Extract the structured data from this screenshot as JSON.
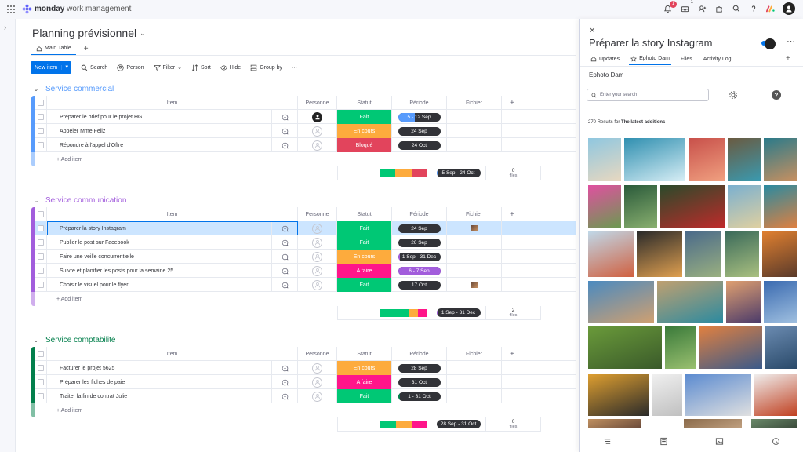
{
  "app": {
    "brand_bold": "monday",
    "brand_rest": " work management",
    "notif_count": "1",
    "inbox_count": "1"
  },
  "board": {
    "title": "Planning prévisionnel",
    "tab_main": "Main Table",
    "tab_add": "+"
  },
  "toolbar": {
    "new_item": "New item",
    "search": "Search",
    "person": "Person",
    "filter": "Filter",
    "sort": "Sort",
    "hide": "Hide",
    "group_by": "Group by",
    "more": "···"
  },
  "columns": {
    "item": "Item",
    "person": "Personne",
    "status": "Statut",
    "period": "Période",
    "file": "Fichier",
    "add": "+"
  },
  "add_item_label": "+ Add item",
  "files_label": "files",
  "groups": [
    {
      "name": "Service commercial",
      "color": "#579bfc",
      "rows": [
        {
          "item": "Préparer le brief pour le projet HGT",
          "person": "dark",
          "status": "Fait",
          "status_color": "#00c875",
          "period": "5 - 12 Sep",
          "progress": 0.4,
          "prog_color": "#579bfc",
          "file": ""
        },
        {
          "item": "Appeler Mme Feliz",
          "person": "empty",
          "status": "En cours",
          "status_color": "#fdab3d",
          "period": "24 Sep",
          "progress": 0,
          "prog_color": "",
          "file": ""
        },
        {
          "item": "Répondre à l'appel d'Offre",
          "person": "empty",
          "status": "Bloqué",
          "status_color": "#e2445c",
          "period": "24 Oct",
          "progress": 0,
          "prog_color": "",
          "file": ""
        }
      ],
      "summary": {
        "period": "5 Sep - 24 Oct",
        "files_count": "0",
        "bar": [
          [
            "#00c875",
            0.33
          ],
          [
            "#fdab3d",
            0.34
          ],
          [
            "#e2445c",
            0.33
          ]
        ],
        "progress": 0.05,
        "prog_color": "#579bfc"
      }
    },
    {
      "name": "Service communication",
      "color": "#a25ddc",
      "rows": [
        {
          "item": "Préparer la story Instagram",
          "person": "empty",
          "status": "Fait",
          "status_color": "#00c875",
          "period": "24 Sep",
          "progress": 0,
          "prog_color": "",
          "file": "thumb",
          "selected": true
        },
        {
          "item": "Publier le post sur Facebook",
          "person": "empty",
          "status": "Fait",
          "status_color": "#00c875",
          "period": "26 Sep",
          "progress": 0,
          "prog_color": "",
          "file": ""
        },
        {
          "item": "Faire une veille concurrentielle",
          "person": "empty",
          "status": "En cours",
          "status_color": "#fdab3d",
          "period": "1 Sep - 31 Dec",
          "progress": 0.05,
          "prog_color": "#a25ddc",
          "file": ""
        },
        {
          "item": "Suivre et planifier les posts pour la semaine 25",
          "person": "empty",
          "status": "A faire",
          "status_color": "#ff158a",
          "period": "6 - 7 Sep",
          "progress": 1,
          "prog_color": "#a25ddc",
          "file": ""
        },
        {
          "item": "Choisir le visuel pour le flyer",
          "person": "empty",
          "status": "Fait",
          "status_color": "#00c875",
          "period": "17 Oct",
          "progress": 0,
          "prog_color": "",
          "file": "thumb"
        }
      ],
      "summary": {
        "period": "1 Sep - 31 Dec",
        "files_count": "2",
        "bar": [
          [
            "#00c875",
            0.6
          ],
          [
            "#fdab3d",
            0.2
          ],
          [
            "#ff158a",
            0.2
          ]
        ],
        "progress": 0.05,
        "prog_color": "#a25ddc"
      }
    },
    {
      "name": "Service comptabilité",
      "color": "#037f4c",
      "rows": [
        {
          "item": "Facturer le projet 5625",
          "person": "empty",
          "status": "En cours",
          "status_color": "#fdab3d",
          "period": "28 Sep",
          "progress": 0,
          "prog_color": "",
          "file": ""
        },
        {
          "item": "Préparer les fiches de paie",
          "person": "empty",
          "status": "A faire",
          "status_color": "#ff158a",
          "period": "31 Oct",
          "progress": 0,
          "prog_color": "",
          "file": ""
        },
        {
          "item": "Traiter la fin de contrat Julie",
          "person": "empty",
          "status": "Fait",
          "status_color": "#00c875",
          "period": "1 - 31 Oct",
          "progress": 0.05,
          "prog_color": "#037f4c",
          "file": ""
        }
      ],
      "summary": {
        "period": "28 Sep - 31 Oct",
        "files_count": "0",
        "bar": [
          [
            "#00c875",
            0.34
          ],
          [
            "#fdab3d",
            0.33
          ],
          [
            "#ff158a",
            0.33
          ]
        ],
        "progress": 0,
        "prog_color": ""
      }
    }
  ],
  "panel": {
    "title": "Préparer la story Instagram",
    "tabs": [
      "Updates",
      "Ephoto Dam",
      "Files",
      "Activity Log"
    ],
    "tab_add": "+",
    "subtitle": "Ephoto Dam",
    "search_placeholder": "Enter your search",
    "help": "?",
    "results_prefix": "270 Results for ",
    "results_bold": "The latest additions"
  }
}
